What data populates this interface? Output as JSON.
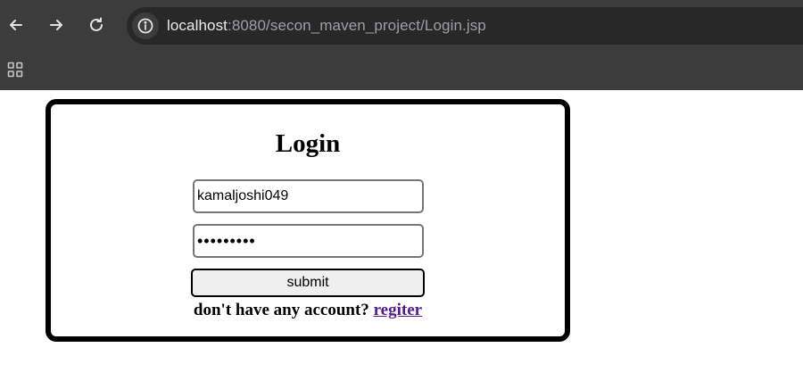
{
  "browser": {
    "url_host": "localhost",
    "url_path": ":8080/secon_maven_project/Login.jsp",
    "back_icon": "arrow-left-icon",
    "forward_icon": "arrow-right-icon",
    "reload_icon": "reload-icon",
    "info_icon": "info-icon",
    "apps_icon": "apps-grid-icon"
  },
  "login": {
    "title": "Login",
    "username_value": "kamaljoshi049",
    "password_value": "•••••••••",
    "submit_label": "submit",
    "account_prompt": "don't have any account?",
    "register_link": "regiter"
  },
  "colors": {
    "chrome_bg": "#3c3c3c",
    "omnibox_bg": "#282828",
    "visited_link": "#551a8b"
  }
}
